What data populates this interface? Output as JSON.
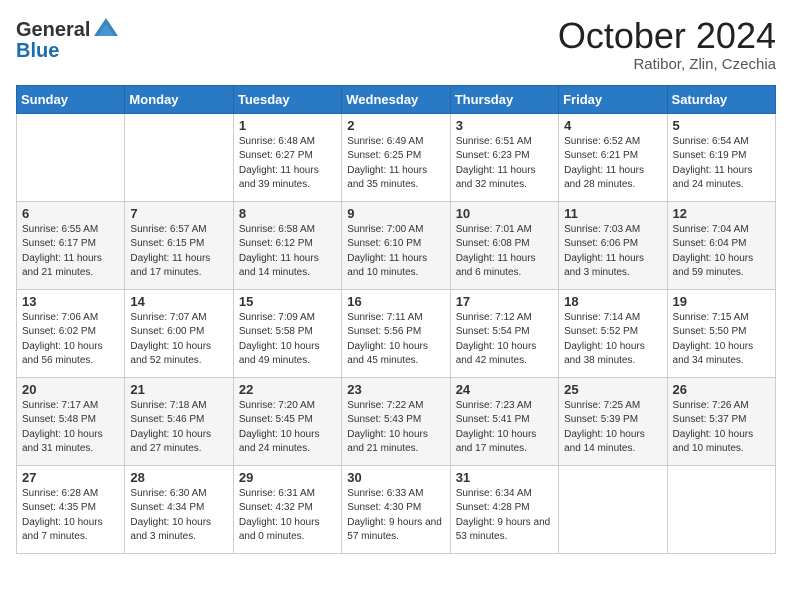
{
  "header": {
    "logo_general": "General",
    "logo_blue": "Blue",
    "month_title": "October 2024",
    "subtitle": "Ratibor, Zlin, Czechia"
  },
  "days_of_week": [
    "Sunday",
    "Monday",
    "Tuesday",
    "Wednesday",
    "Thursday",
    "Friday",
    "Saturday"
  ],
  "weeks": [
    [
      {
        "day": "",
        "info": ""
      },
      {
        "day": "",
        "info": ""
      },
      {
        "day": "1",
        "info": "Sunrise: 6:48 AM\nSunset: 6:27 PM\nDaylight: 11 hours and 39 minutes."
      },
      {
        "day": "2",
        "info": "Sunrise: 6:49 AM\nSunset: 6:25 PM\nDaylight: 11 hours and 35 minutes."
      },
      {
        "day": "3",
        "info": "Sunrise: 6:51 AM\nSunset: 6:23 PM\nDaylight: 11 hours and 32 minutes."
      },
      {
        "day": "4",
        "info": "Sunrise: 6:52 AM\nSunset: 6:21 PM\nDaylight: 11 hours and 28 minutes."
      },
      {
        "day": "5",
        "info": "Sunrise: 6:54 AM\nSunset: 6:19 PM\nDaylight: 11 hours and 24 minutes."
      }
    ],
    [
      {
        "day": "6",
        "info": "Sunrise: 6:55 AM\nSunset: 6:17 PM\nDaylight: 11 hours and 21 minutes."
      },
      {
        "day": "7",
        "info": "Sunrise: 6:57 AM\nSunset: 6:15 PM\nDaylight: 11 hours and 17 minutes."
      },
      {
        "day": "8",
        "info": "Sunrise: 6:58 AM\nSunset: 6:12 PM\nDaylight: 11 hours and 14 minutes."
      },
      {
        "day": "9",
        "info": "Sunrise: 7:00 AM\nSunset: 6:10 PM\nDaylight: 11 hours and 10 minutes."
      },
      {
        "day": "10",
        "info": "Sunrise: 7:01 AM\nSunset: 6:08 PM\nDaylight: 11 hours and 6 minutes."
      },
      {
        "day": "11",
        "info": "Sunrise: 7:03 AM\nSunset: 6:06 PM\nDaylight: 11 hours and 3 minutes."
      },
      {
        "day": "12",
        "info": "Sunrise: 7:04 AM\nSunset: 6:04 PM\nDaylight: 10 hours and 59 minutes."
      }
    ],
    [
      {
        "day": "13",
        "info": "Sunrise: 7:06 AM\nSunset: 6:02 PM\nDaylight: 10 hours and 56 minutes."
      },
      {
        "day": "14",
        "info": "Sunrise: 7:07 AM\nSunset: 6:00 PM\nDaylight: 10 hours and 52 minutes."
      },
      {
        "day": "15",
        "info": "Sunrise: 7:09 AM\nSunset: 5:58 PM\nDaylight: 10 hours and 49 minutes."
      },
      {
        "day": "16",
        "info": "Sunrise: 7:11 AM\nSunset: 5:56 PM\nDaylight: 10 hours and 45 minutes."
      },
      {
        "day": "17",
        "info": "Sunrise: 7:12 AM\nSunset: 5:54 PM\nDaylight: 10 hours and 42 minutes."
      },
      {
        "day": "18",
        "info": "Sunrise: 7:14 AM\nSunset: 5:52 PM\nDaylight: 10 hours and 38 minutes."
      },
      {
        "day": "19",
        "info": "Sunrise: 7:15 AM\nSunset: 5:50 PM\nDaylight: 10 hours and 34 minutes."
      }
    ],
    [
      {
        "day": "20",
        "info": "Sunrise: 7:17 AM\nSunset: 5:48 PM\nDaylight: 10 hours and 31 minutes."
      },
      {
        "day": "21",
        "info": "Sunrise: 7:18 AM\nSunset: 5:46 PM\nDaylight: 10 hours and 27 minutes."
      },
      {
        "day": "22",
        "info": "Sunrise: 7:20 AM\nSunset: 5:45 PM\nDaylight: 10 hours and 24 minutes."
      },
      {
        "day": "23",
        "info": "Sunrise: 7:22 AM\nSunset: 5:43 PM\nDaylight: 10 hours and 21 minutes."
      },
      {
        "day": "24",
        "info": "Sunrise: 7:23 AM\nSunset: 5:41 PM\nDaylight: 10 hours and 17 minutes."
      },
      {
        "day": "25",
        "info": "Sunrise: 7:25 AM\nSunset: 5:39 PM\nDaylight: 10 hours and 14 minutes."
      },
      {
        "day": "26",
        "info": "Sunrise: 7:26 AM\nSunset: 5:37 PM\nDaylight: 10 hours and 10 minutes."
      }
    ],
    [
      {
        "day": "27",
        "info": "Sunrise: 6:28 AM\nSunset: 4:35 PM\nDaylight: 10 hours and 7 minutes."
      },
      {
        "day": "28",
        "info": "Sunrise: 6:30 AM\nSunset: 4:34 PM\nDaylight: 10 hours and 3 minutes."
      },
      {
        "day": "29",
        "info": "Sunrise: 6:31 AM\nSunset: 4:32 PM\nDaylight: 10 hours and 0 minutes."
      },
      {
        "day": "30",
        "info": "Sunrise: 6:33 AM\nSunset: 4:30 PM\nDaylight: 9 hours and 57 minutes."
      },
      {
        "day": "31",
        "info": "Sunrise: 6:34 AM\nSunset: 4:28 PM\nDaylight: 9 hours and 53 minutes."
      },
      {
        "day": "",
        "info": ""
      },
      {
        "day": "",
        "info": ""
      }
    ]
  ]
}
